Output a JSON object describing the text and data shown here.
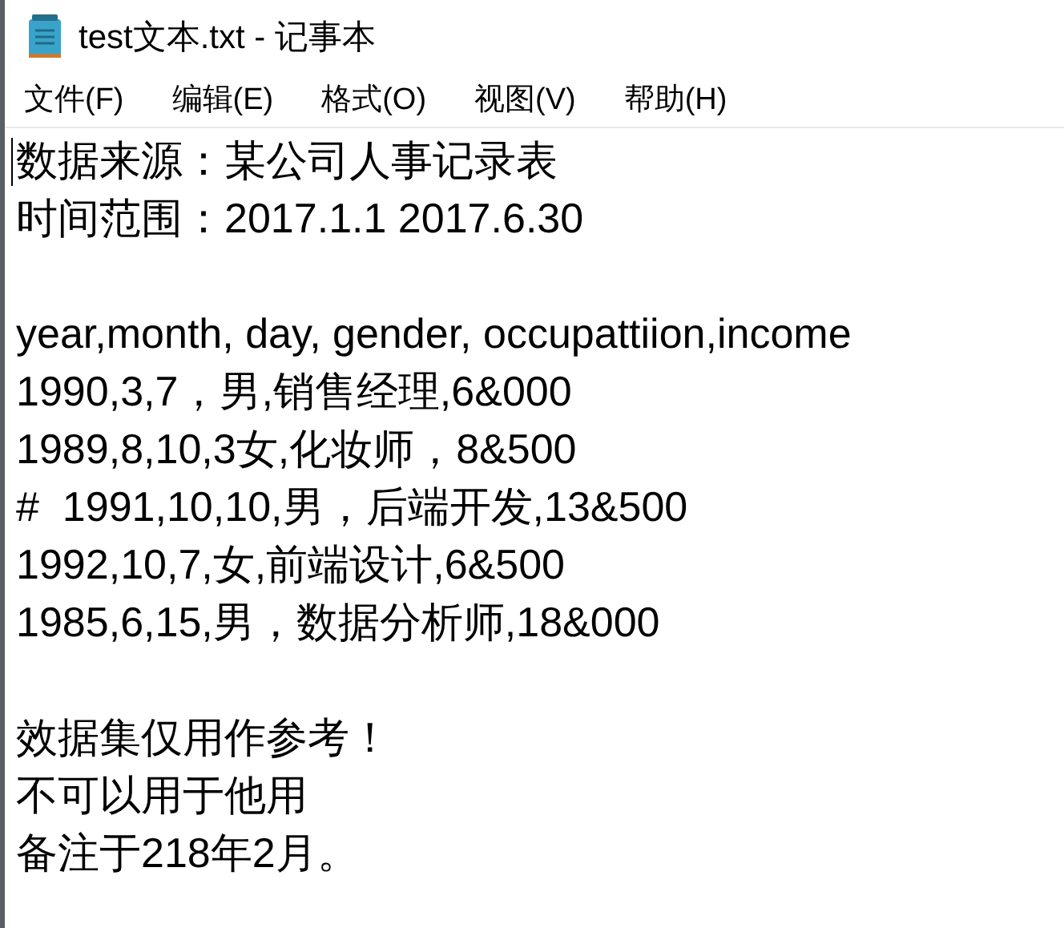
{
  "window": {
    "title": "test文本.txt - 记事本"
  },
  "menu": [
    "文件(F)",
    "编辑(E)",
    "格式(O)",
    "视图(V)",
    "帮助(H)"
  ],
  "editor": {
    "lines": [
      {
        "kind": "text",
        "text": "数据来源：某公司人事记录表"
      },
      {
        "kind": "text",
        "text": "时间范围：2017.1.1 2017.6.30"
      },
      {
        "kind": "blank"
      },
      {
        "kind": "text",
        "text": "year,month, day, gender, occupattiion,income"
      },
      {
        "kind": "text",
        "text": "1990,3,7，男,销售经理,6&000"
      },
      {
        "kind": "text",
        "text": "1989,8,10,3女,化妆师，8&500"
      },
      {
        "kind": "text",
        "text": "#  1991,10,10,男，后端开发,13&500"
      },
      {
        "kind": "text",
        "text": "1992,10,7,女,前端设计,6&500"
      },
      {
        "kind": "text",
        "text": "1985,6,15,男，数据分析师,18&000"
      },
      {
        "kind": "blank"
      },
      {
        "kind": "text",
        "text": "效据集仅用作参考！"
      },
      {
        "kind": "text",
        "text": "不可以用于他用"
      },
      {
        "kind": "text",
        "text": "备注于218年2月。"
      }
    ]
  }
}
